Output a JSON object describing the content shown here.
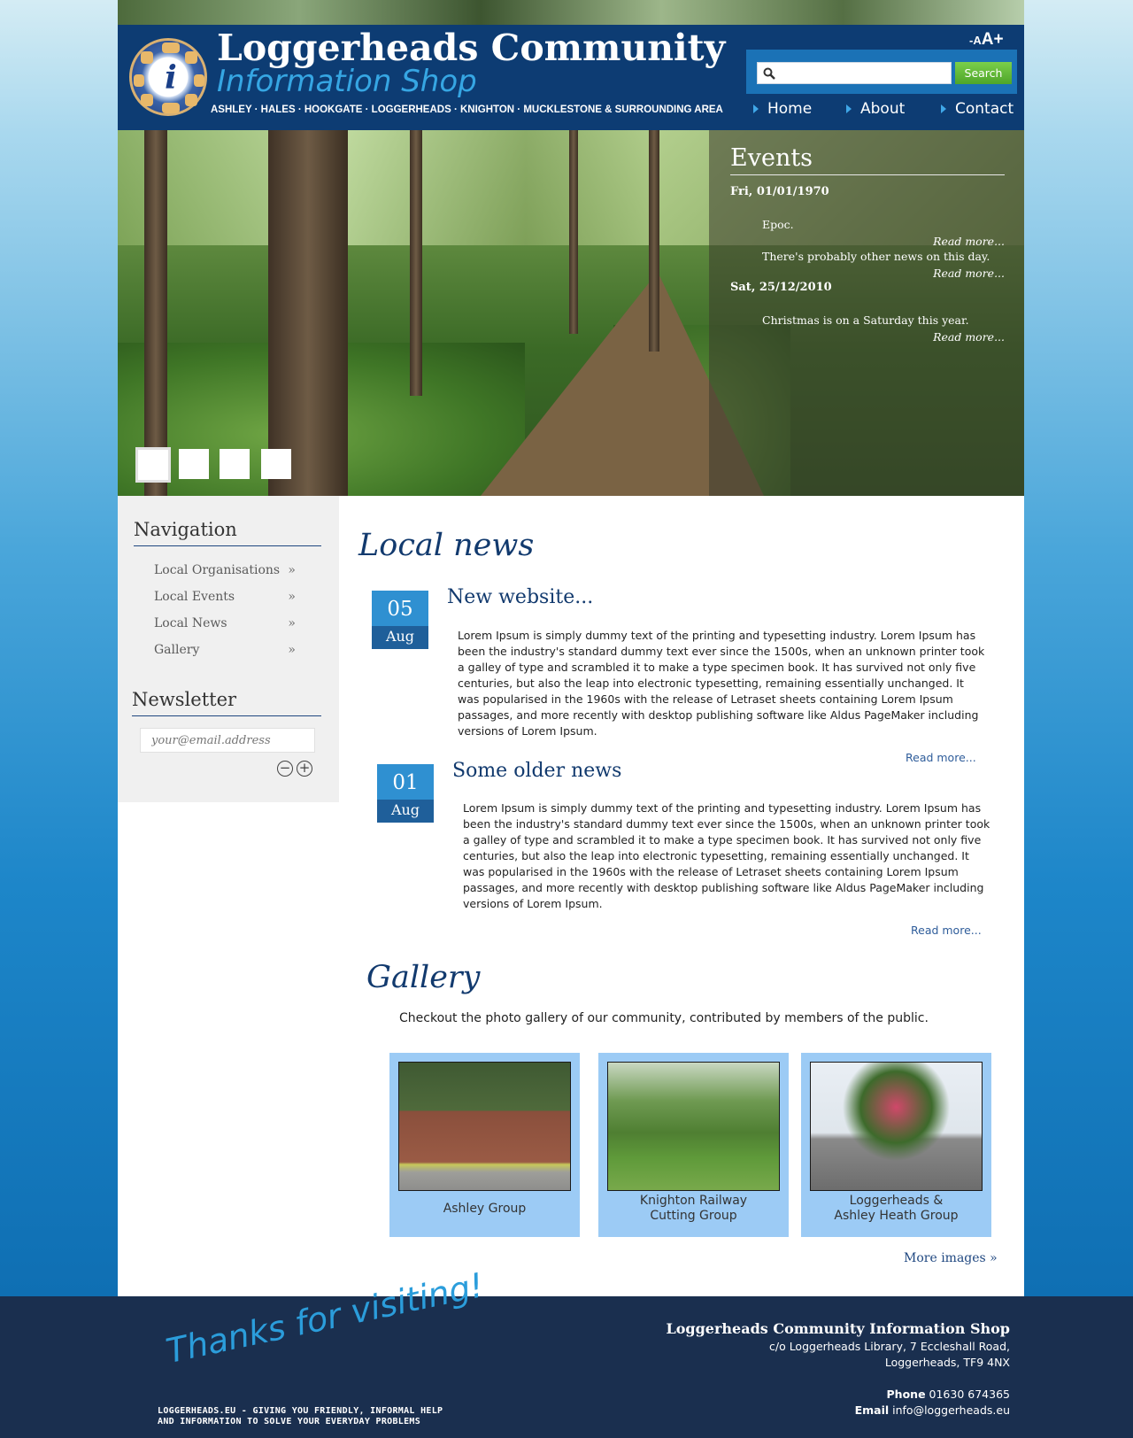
{
  "header": {
    "title": "Loggerheads Community",
    "subtitle": "Information Shop",
    "areas": "ASHLEY · HALES · HOOKGATE · LOGGERHEADS · KNIGHTON · MUCKLESTONE & SURROUNDING AREA",
    "font_small": "-A",
    "font_big": "A+",
    "search_placeholder": "",
    "search_button": "Search",
    "nav": [
      "Home",
      "About",
      "Contact"
    ]
  },
  "events": {
    "heading": "Events",
    "groups": [
      {
        "date": "Fri, 01/01/1970",
        "items": [
          {
            "text": "Epoc.",
            "more": "Read more..."
          },
          {
            "text": "There's probably other news on this day.",
            "more": "Read more..."
          }
        ]
      },
      {
        "date": "Sat, 25/12/2010",
        "items": [
          {
            "text": "Christmas is on a Saturday this year.",
            "more": "Read more..."
          }
        ]
      }
    ]
  },
  "sidebar": {
    "nav_heading": "Navigation",
    "links": [
      "Local Organisations",
      "Local Events",
      "Local News",
      "Gallery"
    ],
    "link_arrow": "»",
    "newsletter_heading": "Newsletter",
    "email_placeholder": "your@email.address"
  },
  "news": {
    "heading": "Local news",
    "items": [
      {
        "day": "05",
        "month": "Aug",
        "title": "New website...",
        "body": "Lorem Ipsum is simply dummy text of the printing and typesetting industry. Lorem Ipsum has been the industry's standard dummy text ever since the 1500s, when an unknown printer took a galley of type and scrambled it to make a type specimen book. It has survived not only five centuries, but also the leap into electronic typesetting, remaining essentially unchanged. It was popularised in the 1960s with the release of Letraset sheets containing Lorem Ipsum passages, and more recently with desktop publishing software like Aldus PageMaker including versions of Lorem Ipsum.",
        "more": "Read more..."
      },
      {
        "day": "01",
        "month": "Aug",
        "title": "Some older news",
        "body": "Lorem Ipsum is simply dummy text of the printing and typesetting industry. Lorem Ipsum has been the industry's standard dummy text ever since the 1500s, when an unknown printer took a galley of type and scrambled it to make a type specimen book. It has survived not only five centuries, but also the leap into electronic typesetting, remaining essentially unchanged. It was popularised in the 1960s with the release of Letraset sheets containing Lorem Ipsum passages, and more recently with desktop publishing software like Aldus PageMaker including versions of Lorem Ipsum.",
        "more": "Read more..."
      }
    ]
  },
  "gallery": {
    "heading": "Gallery",
    "intro": "Checkout the photo gallery of our community, contributed by members of the public.",
    "cards": [
      {
        "line1": "Ashley Group",
        "line2": ""
      },
      {
        "line1": "Knighton Railway",
        "line2": "Cutting Group"
      },
      {
        "line1": "Loggerheads &",
        "line2": "Ashley Heath Group"
      }
    ],
    "more": "More images »"
  },
  "footer": {
    "thanks": "Thanks for visiting!",
    "tagline1": "LOGGERHEADS.EU - GIVING YOU FRIENDLY, INFORMAL HELP",
    "tagline2": "AND INFORMATION TO SOLVE YOUR EVERYDAY PROBLEMS",
    "org": "Loggerheads Community Information Shop",
    "address1": "c/o Loggerheads Library, 7 Eccleshall Road,",
    "address2": "Loggerheads, TF9 4NX",
    "phone_label": "Phone",
    "phone": "01630 674365",
    "email_label": "Email",
    "email": "info@loggerheads.eu"
  },
  "colors": {
    "header_bg": "#0d3c73",
    "accent_blue": "#2f90d1",
    "search_green": "#5bb533",
    "footer_bg": "#1a2f4f"
  }
}
